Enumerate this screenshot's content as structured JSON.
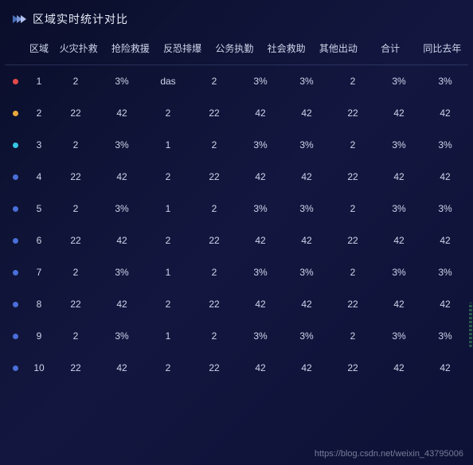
{
  "header": {
    "title": "区域实时统计对比"
  },
  "columns": [
    "区域",
    "火灾扑救",
    "抢险救援",
    "反恐排爆",
    "公务执勤",
    "社会救助",
    "其他出动",
    "合计",
    "同比去年"
  ],
  "dot_colors": [
    "#e54b4b",
    "#e8a73c",
    "#38c6e8",
    "#4a6fd8",
    "#4a6fd8",
    "#4a6fd8",
    "#4a6fd8",
    "#4a6fd8",
    "#4a6fd8",
    "#4a6fd8"
  ],
  "rows": [
    {
      "idx": "1",
      "cells": [
        "2",
        "3%",
        "das",
        "2",
        "3%",
        "3%",
        "2",
        "3%",
        "3%"
      ]
    },
    {
      "idx": "2",
      "cells": [
        "22",
        "42",
        "2",
        "22",
        "42",
        "42",
        "22",
        "42",
        "42"
      ]
    },
    {
      "idx": "3",
      "cells": [
        "2",
        "3%",
        "1",
        "2",
        "3%",
        "3%",
        "2",
        "3%",
        "3%"
      ]
    },
    {
      "idx": "4",
      "cells": [
        "22",
        "42",
        "2",
        "22",
        "42",
        "42",
        "22",
        "42",
        "42"
      ]
    },
    {
      "idx": "5",
      "cells": [
        "2",
        "3%",
        "1",
        "2",
        "3%",
        "3%",
        "2",
        "3%",
        "3%"
      ]
    },
    {
      "idx": "6",
      "cells": [
        "22",
        "42",
        "2",
        "22",
        "42",
        "42",
        "22",
        "42",
        "42"
      ]
    },
    {
      "idx": "7",
      "cells": [
        "2",
        "3%",
        "1",
        "2",
        "3%",
        "3%",
        "2",
        "3%",
        "3%"
      ]
    },
    {
      "idx": "8",
      "cells": [
        "22",
        "42",
        "2",
        "22",
        "42",
        "42",
        "22",
        "42",
        "42"
      ]
    },
    {
      "idx": "9",
      "cells": [
        "2",
        "3%",
        "1",
        "2",
        "3%",
        "3%",
        "2",
        "3%",
        "3%"
      ]
    },
    {
      "idx": "10",
      "cells": [
        "22",
        "42",
        "2",
        "22",
        "42",
        "42",
        "22",
        "42",
        "42"
      ]
    }
  ],
  "watermark": "https://blog.csdn.net/weixin_43795006"
}
